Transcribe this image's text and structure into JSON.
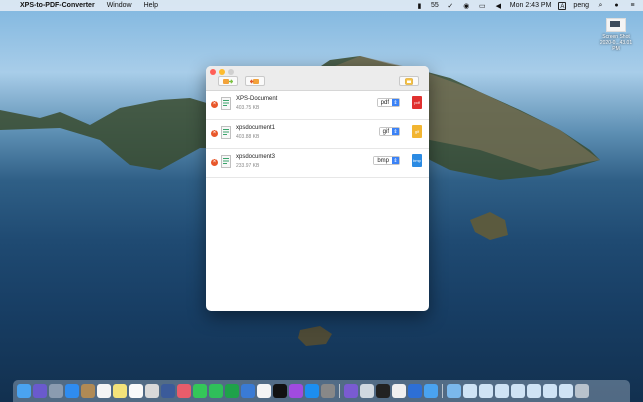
{
  "menubar": {
    "app_name": "XPS-to-PDF-Converter",
    "menus": [
      "Window",
      "Help"
    ],
    "battery_text": "55",
    "clock": "Mon 2:43 PM",
    "input_source": "A",
    "user": "peng"
  },
  "desktop": {
    "icon_label_line1": "Screen Shot",
    "icon_label_line2": "2020-0...43.01 PM"
  },
  "window": {
    "files": [
      {
        "name": "XPS-Document",
        "size": "403.75 KB",
        "format": "pdf",
        "out_label": "pdf",
        "out_color": "#e0312f"
      },
      {
        "name": "xpsdocument1",
        "size": "403.88 KB",
        "format": "gif",
        "out_label": "gif",
        "out_color": "#f2b531"
      },
      {
        "name": "xpsdocument3",
        "size": "233.97 KB",
        "format": "bmp",
        "out_label": "bmp",
        "out_color": "#2b8be3"
      }
    ]
  },
  "colors": {
    "accent": "#3b82f6",
    "remove": "#e8572a",
    "toolbar_icon": "#f2a23a"
  },
  "dock": {
    "apps": [
      "finder",
      "siri",
      "launchpad",
      "safari",
      "contacts",
      "calendar",
      "notes",
      "reminders",
      "preview",
      "photos",
      "messages",
      "facetime",
      "numbers",
      "keynote",
      "music",
      "tv",
      "podcasts",
      "appstore",
      "settings",
      "xcode-helper",
      "quicktime",
      "terminal",
      "qq",
      "writer",
      "screensharing"
    ]
  }
}
